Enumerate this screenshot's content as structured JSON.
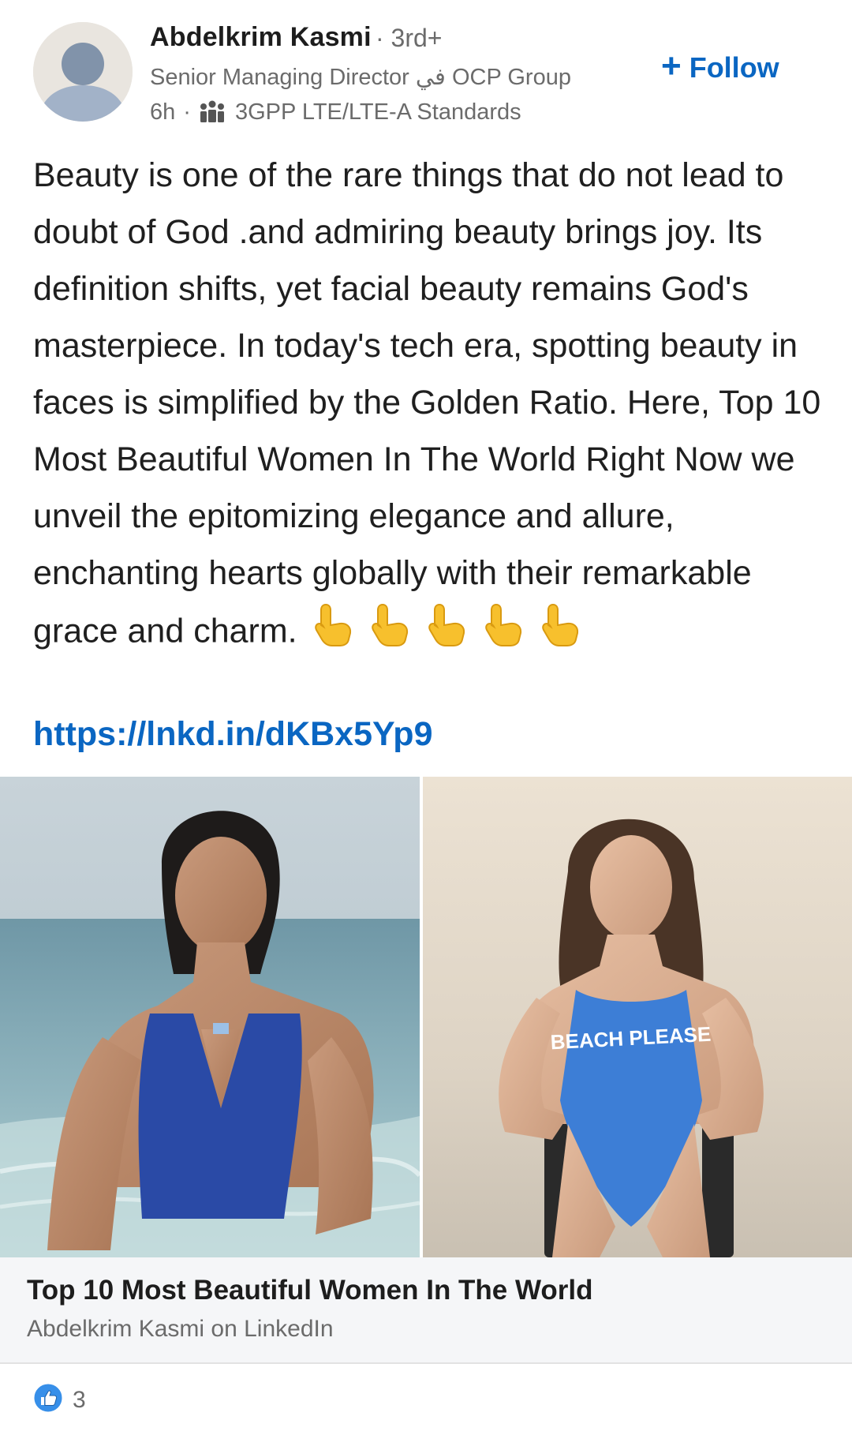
{
  "post": {
    "author": {
      "name": "Abdelkrim Kasmi",
      "degree": "· 3rd+",
      "headline": "Senior Managing Director في OCP Group",
      "time": "6h",
      "separator": "·",
      "group": "3GPP LTE/LTE-A Standards",
      "avatar_icon": "person-placeholder-icon",
      "group_icon": "group-icon"
    },
    "follow": {
      "icon": "+",
      "label": "Follow",
      "color": "#0a66c2"
    },
    "body_text": "Beauty is one of the rare things that do not lead to doubt of God .and admiring beauty brings joy. Its definition shifts, yet facial beauty remains God's masterpiece. In today's tech era, spotting beauty in faces is simplified by the Golden Ratio. Here, Top 10 Most Beautiful Women In The World Right Now we unveil the epitomizing elegance and allure, enchanting hearts globally with their remarkable grace and charm.",
    "emoji": [
      "👇",
      "👇",
      "👇",
      "👇",
      "👇"
    ],
    "link": "https://lnkd.in/dKBx5Yp9",
    "article": {
      "swimsuit_text": "BEACH PLEASE",
      "title": "Top 10 Most Beautiful Women In The World",
      "source": "Abdelkrim Kasmi on LinkedIn"
    },
    "reactions": {
      "icon": "like-icon",
      "count": "3",
      "color": "#378fe9"
    }
  }
}
